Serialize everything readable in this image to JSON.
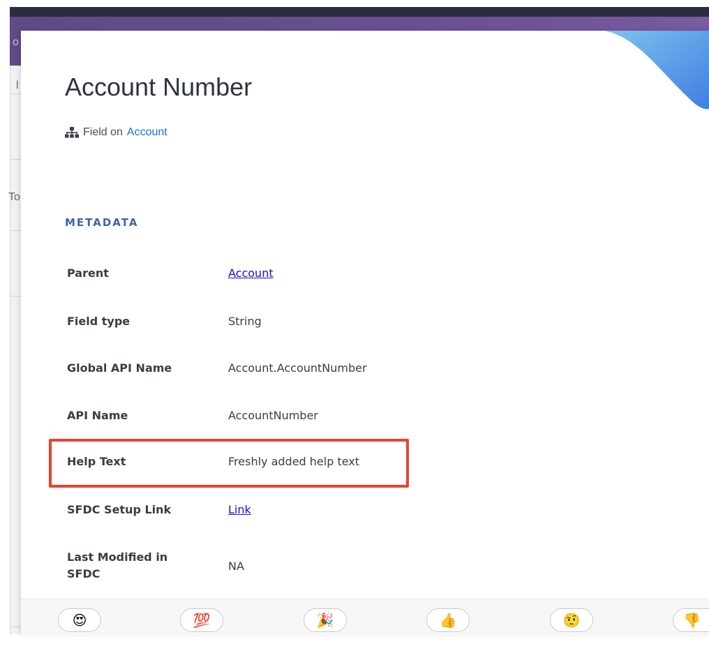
{
  "background": {
    "left_chars": [
      "o",
      "l",
      "To"
    ]
  },
  "modal": {
    "title": "Account Number",
    "subtitle_prefix": "Field on",
    "subtitle_link": "Account",
    "subtitle_icon": "hierarchy-icon",
    "section_heading": "METADATA",
    "rows": [
      {
        "label": "Parent",
        "value": "Account",
        "is_link": true
      },
      {
        "label": "Field type",
        "value": "String",
        "is_link": false
      },
      {
        "label": "Global API Name",
        "value": "Account.AccountNumber",
        "is_link": false
      },
      {
        "label": "API Name",
        "value": "AccountNumber",
        "is_link": false
      },
      {
        "label": "Help Text",
        "value": "Freshly added help text",
        "is_link": false,
        "highlighted": true
      },
      {
        "label": "SFDC Setup Link",
        "value": "Link",
        "is_link": true
      },
      {
        "label": "Last Modified in SFDC",
        "value": "NA",
        "is_link": false
      }
    ],
    "highlight_color": "#e8432f",
    "accent_color": "#3f63a6",
    "link_color": "#1a0dcc"
  },
  "reactions": [
    {
      "name": "heart-eyes",
      "glyph": "😍"
    },
    {
      "name": "hundred-points",
      "glyph": "💯"
    },
    {
      "name": "party-popper",
      "glyph": "🎉"
    },
    {
      "name": "thumbs-up",
      "glyph": "👍"
    },
    {
      "name": "raised-eyebrow",
      "glyph": "🤨"
    },
    {
      "name": "thumbs-down",
      "glyph": "👎"
    }
  ]
}
